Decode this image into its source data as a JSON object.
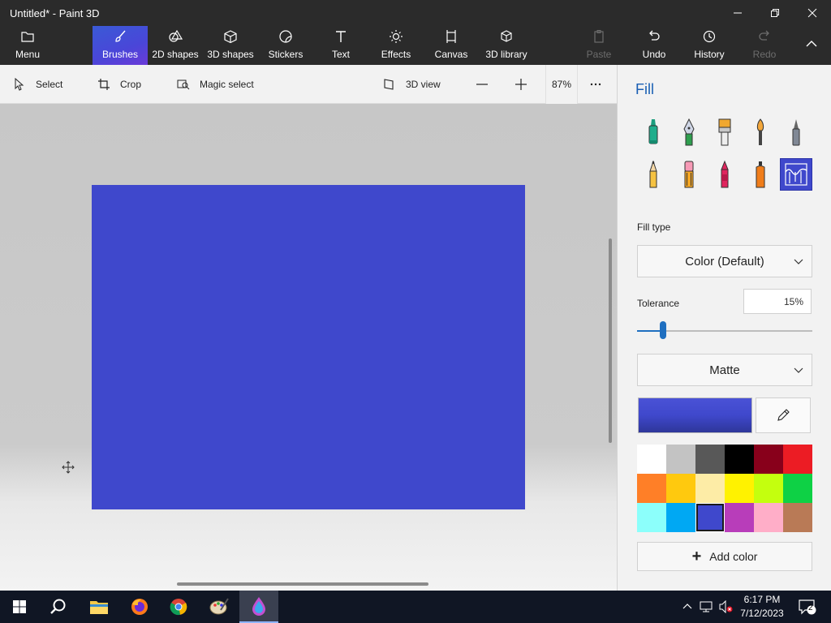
{
  "window": {
    "title": "Untitled* - Paint 3D"
  },
  "ribbon": {
    "menu": "Menu",
    "brushes": "Brushes",
    "shapes2d": "2D shapes",
    "shapes3d": "3D shapes",
    "stickers": "Stickers",
    "text": "Text",
    "effects": "Effects",
    "canvas": "Canvas",
    "library3d": "3D library",
    "paste": "Paste",
    "undo": "Undo",
    "history": "History",
    "redo": "Redo"
  },
  "toolbar": {
    "select": "Select",
    "crop": "Crop",
    "magic_select": "Magic select",
    "view3d": "3D view",
    "zoom": "87%"
  },
  "panel": {
    "title": "Fill",
    "brushes": [
      "marker",
      "calligraphy-pen",
      "oil-brush",
      "watercolor",
      "pixel-pen",
      "pencil",
      "eraser",
      "crayon",
      "spray-can",
      "fill"
    ],
    "selected_brush": "fill",
    "fill_type_label": "Fill type",
    "fill_type_value": "Color (Default)",
    "tolerance_label": "Tolerance",
    "tolerance_value": "15%",
    "tolerance_fraction": 0.15,
    "finish_value": "Matte",
    "current_color": "#3f48cc",
    "palette": [
      "#ffffff",
      "#c3c3c3",
      "#585858",
      "#000000",
      "#88001b",
      "#ec1c24",
      "#ff7f27",
      "#ffc90e",
      "#fdeca6",
      "#fff200",
      "#c4ff0e",
      "#0ed145",
      "#8cfffb",
      "#00a8f3",
      "#3f48cc",
      "#b83dba",
      "#ffaec8",
      "#b97a56"
    ],
    "selected_palette_index": 14,
    "add_color": "Add color"
  },
  "canvas": {
    "fill_color": "#3f48cc"
  },
  "taskbar": {
    "time": "6:17 PM",
    "date": "7/12/2023",
    "notifications": "2"
  }
}
